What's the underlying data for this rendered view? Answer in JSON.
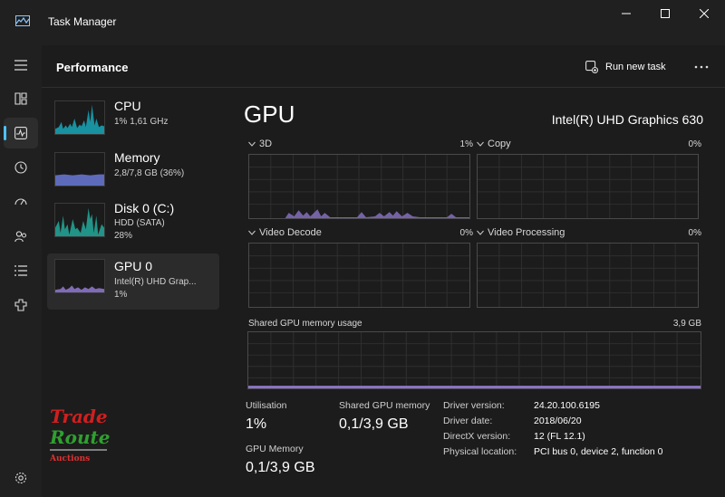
{
  "window": {
    "title": "Task Manager"
  },
  "header": {
    "title": "Performance",
    "run_new_task": "Run new task"
  },
  "nav": [
    "hamburger-icon",
    "processes-icon",
    "performance-icon",
    "app-history-icon",
    "startup-icon",
    "users-icon",
    "details-icon",
    "services-icon",
    "settings-icon"
  ],
  "perf_items": [
    {
      "name": "CPU",
      "sub1": "1%  1,61 GHz",
      "sub2": ""
    },
    {
      "name": "Memory",
      "sub1": "2,8/7,8 GB (36%)",
      "sub2": ""
    },
    {
      "name": "Disk 0 (C:)",
      "sub1": "HDD (SATA)",
      "sub2": "28%"
    },
    {
      "name": "GPU 0",
      "sub1": "Intel(R) UHD Grap...",
      "sub2": "1%"
    }
  ],
  "gpu": {
    "title": "GPU",
    "model": "Intel(R) UHD Graphics 630",
    "graphs": [
      {
        "label": "3D",
        "pct": "1%"
      },
      {
        "label": "Copy",
        "pct": "0%"
      },
      {
        "label": "Video Decode",
        "pct": "0%"
      },
      {
        "label": "Video Processing",
        "pct": "0%"
      }
    ],
    "shared_graph": {
      "label": "Shared GPU memory usage",
      "value": "3,9 GB"
    },
    "stats": {
      "utilisation_label": "Utilisation",
      "utilisation": "1%",
      "shared_label": "Shared GPU memory",
      "shared": "0,1/3,9 GB",
      "gpu_memory_label": "GPU Memory",
      "gpu_memory": "0,1/3,9 GB"
    },
    "details": [
      {
        "label": "Driver version:",
        "value": "24.20.100.6195"
      },
      {
        "label": "Driver date:",
        "value": "2018/06/20"
      },
      {
        "label": "DirectX version:",
        "value": "12 (FL 12.1)"
      },
      {
        "label": "Physical location:",
        "value": "PCI bus 0, device 2, function 0"
      }
    ]
  },
  "watermark": {
    "line1": "Trade",
    "line2": "Route",
    "line3": "Auctions"
  },
  "colors": {
    "accent": "#4cc2ff",
    "cpu": "#17a6b8",
    "memory": "#6a79d6",
    "gpu": "#8c74c8"
  }
}
